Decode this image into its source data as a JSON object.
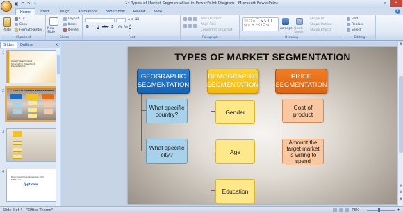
{
  "window": {
    "title": "14-Types-of-Market-Segmentation-in-PowerPoint-Diagram - Microsoft PowerPoint",
    "controls": [
      "–",
      "▫",
      "✕"
    ]
  },
  "ribbon_tabs": [
    "Home",
    "Insert",
    "Design",
    "Animations",
    "Slide Show",
    "Review",
    "View"
  ],
  "ribbon": {
    "clipboard": {
      "label": "Clipboard",
      "paste": "Paste",
      "cut": "Cut",
      "copy": "Copy",
      "format_painter": "Format Painter"
    },
    "slides": {
      "label": "Slides",
      "new_slide": "New Slide",
      "layout": "Layout",
      "reset": "Reset",
      "delete": "Delete"
    },
    "font": {
      "label": "Font",
      "bold": "B",
      "italic": "I",
      "underline": "U",
      "strike": "abe",
      "shadow": "S"
    },
    "paragraph": {
      "label": "Paragraph",
      "text_direction": "Text Direction",
      "align_text": "Align Text",
      "convert": "Convert to SmartArt"
    },
    "drawing": {
      "label": "Drawing",
      "arrange": "Arrange",
      "quick_styles": "Quick Styles",
      "shape_fill": "Shape Fill",
      "shape_outline": "Shape Outline",
      "shape_effects": "Shape Effects"
    },
    "editing": {
      "label": "Editing",
      "find": "Find",
      "replace": "Replace",
      "select": "Select"
    }
  },
  "left_panel": {
    "tabs": [
      "Slides",
      "Outline"
    ],
    "close": "x",
    "thumbnails": [
      {
        "num": "1",
        "text": "Using Hierarchy List SmartArt in PowerPoint Presentations"
      },
      {
        "num": "2",
        "text": "TYPES OF MARKET SEGMENTATION"
      },
      {
        "num": "3",
        "text": ""
      },
      {
        "num": "4",
        "text": "Download more templates from FPPT.com",
        "brand": "fppt.com"
      }
    ]
  },
  "slide": {
    "title": "TYPES OF MARKET SEGMENTATION",
    "columns": [
      {
        "header": "GEOGRAPHIC SEGMENTATION",
        "items": [
          "What specific country?",
          "What specific city?"
        ]
      },
      {
        "header": "DEMOGRAPHIC SEGMENTATION",
        "items": [
          "Gender",
          "Age",
          "Education"
        ]
      },
      {
        "header": "PRICE SEGMENTATION",
        "items": [
          "Cost of product",
          "Amount the target market is willing to spend"
        ]
      }
    ]
  },
  "status": {
    "slide_info": "Slide 2 of 4",
    "theme": "\"Office Theme\"",
    "zoom": "73%"
  },
  "colors": {
    "geo": "#1f6fc0",
    "demo": "#f5c21a",
    "price": "#e46e17",
    "geo_item": "#a7d2e9",
    "demo_item": "#ffe889",
    "price_item": "#f8c8a2"
  }
}
